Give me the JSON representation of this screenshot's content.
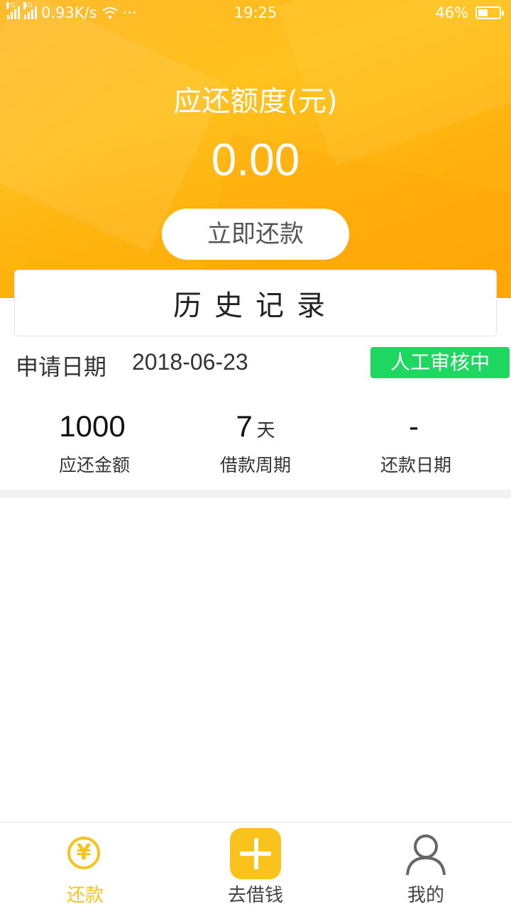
{
  "status_bar": {
    "network": "0.93K/s",
    "time": "19:25",
    "battery": "46%",
    "battery_level": 0.46,
    "signal_tags": [
      "2G",
      "4G"
    ],
    "more": "···"
  },
  "header": {
    "title": "应还额度(元)",
    "amount": "0.00",
    "repay_button": "立即还款"
  },
  "history": {
    "title": "历史记录"
  },
  "record": {
    "apply_label": "申请日期",
    "apply_date": "2018-06-23",
    "status": "人工审核中",
    "status_color": "#1ed760",
    "stats": [
      {
        "value": "1000",
        "unit": "",
        "label": "应还金额"
      },
      {
        "value": "7",
        "unit": "天",
        "label": "借款周期"
      },
      {
        "value": "-",
        "unit": "",
        "label": "还款日期"
      }
    ]
  },
  "nav": {
    "items": [
      {
        "label": "还款",
        "icon": "yen-icon",
        "active": true
      },
      {
        "label": "去借钱",
        "icon": "plus-icon",
        "active": false
      },
      {
        "label": "我的",
        "icon": "user-icon",
        "active": false
      }
    ],
    "accent": "#f7c31d"
  }
}
